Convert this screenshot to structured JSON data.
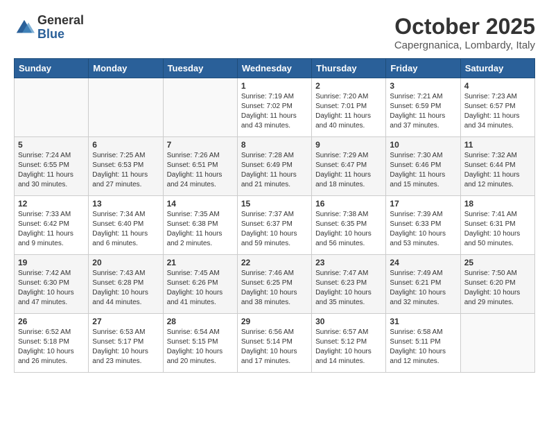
{
  "header": {
    "logo_general": "General",
    "logo_blue": "Blue",
    "month_title": "October 2025",
    "subtitle": "Capergnanica, Lombardy, Italy"
  },
  "days_of_week": [
    "Sunday",
    "Monday",
    "Tuesday",
    "Wednesday",
    "Thursday",
    "Friday",
    "Saturday"
  ],
  "weeks": [
    [
      {
        "day": "",
        "info": ""
      },
      {
        "day": "",
        "info": ""
      },
      {
        "day": "",
        "info": ""
      },
      {
        "day": "1",
        "info": "Sunrise: 7:19 AM\nSunset: 7:02 PM\nDaylight: 11 hours and 43 minutes."
      },
      {
        "day": "2",
        "info": "Sunrise: 7:20 AM\nSunset: 7:01 PM\nDaylight: 11 hours and 40 minutes."
      },
      {
        "day": "3",
        "info": "Sunrise: 7:21 AM\nSunset: 6:59 PM\nDaylight: 11 hours and 37 minutes."
      },
      {
        "day": "4",
        "info": "Sunrise: 7:23 AM\nSunset: 6:57 PM\nDaylight: 11 hours and 34 minutes."
      }
    ],
    [
      {
        "day": "5",
        "info": "Sunrise: 7:24 AM\nSunset: 6:55 PM\nDaylight: 11 hours and 30 minutes."
      },
      {
        "day": "6",
        "info": "Sunrise: 7:25 AM\nSunset: 6:53 PM\nDaylight: 11 hours and 27 minutes."
      },
      {
        "day": "7",
        "info": "Sunrise: 7:26 AM\nSunset: 6:51 PM\nDaylight: 11 hours and 24 minutes."
      },
      {
        "day": "8",
        "info": "Sunrise: 7:28 AM\nSunset: 6:49 PM\nDaylight: 11 hours and 21 minutes."
      },
      {
        "day": "9",
        "info": "Sunrise: 7:29 AM\nSunset: 6:47 PM\nDaylight: 11 hours and 18 minutes."
      },
      {
        "day": "10",
        "info": "Sunrise: 7:30 AM\nSunset: 6:46 PM\nDaylight: 11 hours and 15 minutes."
      },
      {
        "day": "11",
        "info": "Sunrise: 7:32 AM\nSunset: 6:44 PM\nDaylight: 11 hours and 12 minutes."
      }
    ],
    [
      {
        "day": "12",
        "info": "Sunrise: 7:33 AM\nSunset: 6:42 PM\nDaylight: 11 hours and 9 minutes."
      },
      {
        "day": "13",
        "info": "Sunrise: 7:34 AM\nSunset: 6:40 PM\nDaylight: 11 hours and 6 minutes."
      },
      {
        "day": "14",
        "info": "Sunrise: 7:35 AM\nSunset: 6:38 PM\nDaylight: 11 hours and 2 minutes."
      },
      {
        "day": "15",
        "info": "Sunrise: 7:37 AM\nSunset: 6:37 PM\nDaylight: 10 hours and 59 minutes."
      },
      {
        "day": "16",
        "info": "Sunrise: 7:38 AM\nSunset: 6:35 PM\nDaylight: 10 hours and 56 minutes."
      },
      {
        "day": "17",
        "info": "Sunrise: 7:39 AM\nSunset: 6:33 PM\nDaylight: 10 hours and 53 minutes."
      },
      {
        "day": "18",
        "info": "Sunrise: 7:41 AM\nSunset: 6:31 PM\nDaylight: 10 hours and 50 minutes."
      }
    ],
    [
      {
        "day": "19",
        "info": "Sunrise: 7:42 AM\nSunset: 6:30 PM\nDaylight: 10 hours and 47 minutes."
      },
      {
        "day": "20",
        "info": "Sunrise: 7:43 AM\nSunset: 6:28 PM\nDaylight: 10 hours and 44 minutes."
      },
      {
        "day": "21",
        "info": "Sunrise: 7:45 AM\nSunset: 6:26 PM\nDaylight: 10 hours and 41 minutes."
      },
      {
        "day": "22",
        "info": "Sunrise: 7:46 AM\nSunset: 6:25 PM\nDaylight: 10 hours and 38 minutes."
      },
      {
        "day": "23",
        "info": "Sunrise: 7:47 AM\nSunset: 6:23 PM\nDaylight: 10 hours and 35 minutes."
      },
      {
        "day": "24",
        "info": "Sunrise: 7:49 AM\nSunset: 6:21 PM\nDaylight: 10 hours and 32 minutes."
      },
      {
        "day": "25",
        "info": "Sunrise: 7:50 AM\nSunset: 6:20 PM\nDaylight: 10 hours and 29 minutes."
      }
    ],
    [
      {
        "day": "26",
        "info": "Sunrise: 6:52 AM\nSunset: 5:18 PM\nDaylight: 10 hours and 26 minutes."
      },
      {
        "day": "27",
        "info": "Sunrise: 6:53 AM\nSunset: 5:17 PM\nDaylight: 10 hours and 23 minutes."
      },
      {
        "day": "28",
        "info": "Sunrise: 6:54 AM\nSunset: 5:15 PM\nDaylight: 10 hours and 20 minutes."
      },
      {
        "day": "29",
        "info": "Sunrise: 6:56 AM\nSunset: 5:14 PM\nDaylight: 10 hours and 17 minutes."
      },
      {
        "day": "30",
        "info": "Sunrise: 6:57 AM\nSunset: 5:12 PM\nDaylight: 10 hours and 14 minutes."
      },
      {
        "day": "31",
        "info": "Sunrise: 6:58 AM\nSunset: 5:11 PM\nDaylight: 10 hours and 12 minutes."
      },
      {
        "day": "",
        "info": ""
      }
    ]
  ]
}
